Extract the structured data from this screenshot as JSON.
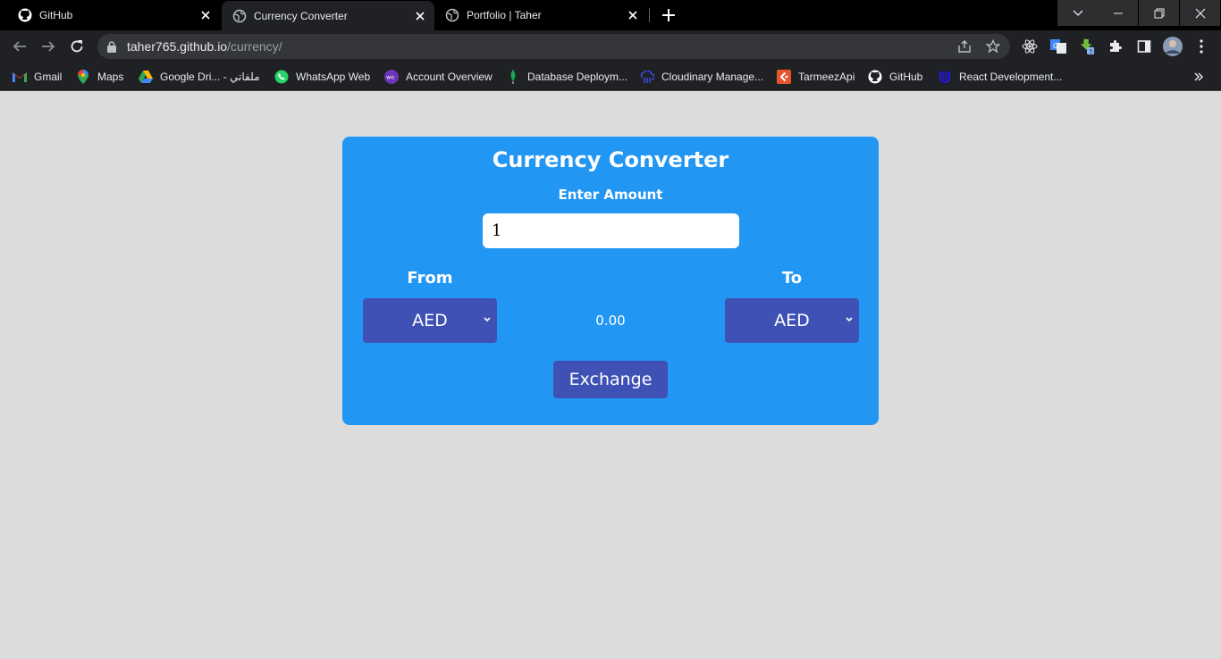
{
  "browser": {
    "tabs": [
      {
        "title": "GitHub",
        "icon": "github-icon",
        "active": false
      },
      {
        "title": "Currency Converter",
        "icon": "globe-icon",
        "active": true
      },
      {
        "title": "Portfolio | Taher",
        "icon": "globe-icon",
        "active": false
      }
    ],
    "url_host": "taher765.github.io",
    "url_path": "/currency/",
    "bookmarks": [
      {
        "label": "Gmail",
        "icon": "gmail-icon"
      },
      {
        "label": "Maps",
        "icon": "maps-icon"
      },
      {
        "label": "Google Dri... - ملفاتي",
        "icon": "google-drive-icon"
      },
      {
        "label": "WhatsApp Web",
        "icon": "whatsapp-icon"
      },
      {
        "label": "Account Overview",
        "icon": "account-icon"
      },
      {
        "label": "Database Deploym...",
        "icon": "mongodb-icon"
      },
      {
        "label": "Cloudinary Manage...",
        "icon": "cloudinary-icon"
      },
      {
        "label": "TarmeezApi",
        "icon": "tarmeez-icon"
      },
      {
        "label": "GitHub",
        "icon": "github-icon"
      },
      {
        "label": "React Development...",
        "icon": "udacity-icon"
      }
    ]
  },
  "converter": {
    "title": "Currency Converter",
    "amount_label": "Enter Amount",
    "amount_value": "1",
    "from_label": "From",
    "to_label": "To",
    "from_currency": "AED",
    "to_currency": "AED",
    "result": "0.00",
    "exchange_label": "Exchange"
  },
  "colors": {
    "page_bg": "#dcdcdc",
    "card_bg": "#2196f3",
    "control_bg": "#3f51b5"
  }
}
